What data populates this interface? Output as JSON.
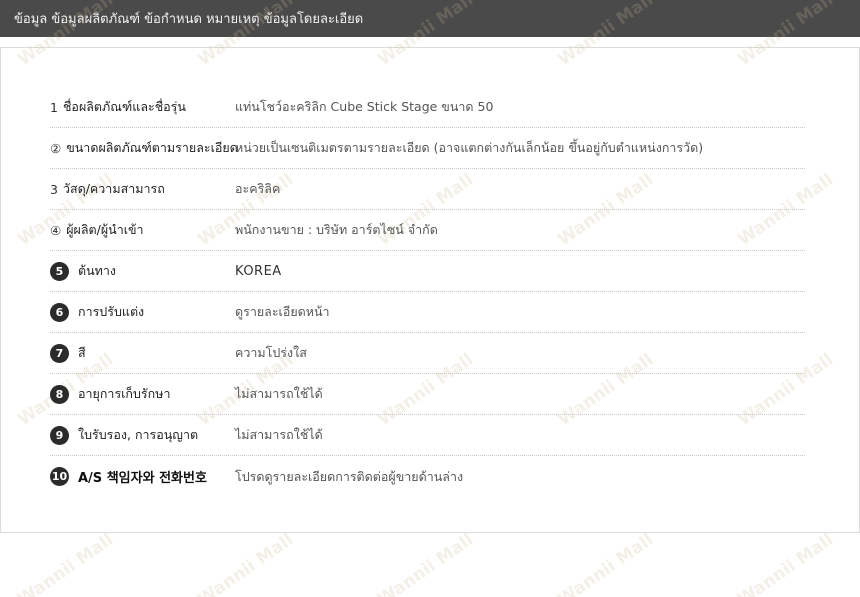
{
  "header": {
    "title": "ข้อมูล ข้อมูลผลิตภัณฑ์ ข้อกำหนด หมายเหตุ ข้อมูลโดยละเอียด"
  },
  "watermark_text": "Wannii Mall",
  "specs": [
    {
      "number": "1",
      "label": "ชื่อผลิตภัณฑ์และชื่อรุ่น",
      "value": "แท่นโชว์อะคริลิก Cube Stick Stage ขนาด 50"
    },
    {
      "number": "②",
      "label": "ขนาดผลิตภัณฑ์ตามรายละเอียด",
      "value": "หน่วยเป็นเซนติเมตรตามรายละเอียด (อาจแตกต่างกันเล็กน้อย ขึ้นอยู่กับตำแหน่งการวัด)"
    },
    {
      "number": "3",
      "label": "วัสดุ/ความสามารถ",
      "value": "อะคริลิค"
    },
    {
      "number": "④",
      "label": "ผู้ผลิต/ผู้นำเข้า",
      "value": "พนักงานขาย : บริษัท อาร์ตไซน์ จำกัด"
    },
    {
      "number": "5",
      "label": "ต้นทาง",
      "value": "KOREA"
    },
    {
      "number": "6",
      "label": "การปรับแต่ง",
      "value": "ดูรายละเอียดหน้า"
    },
    {
      "number": "7",
      "label": "สี",
      "value": "ความโปร่งใส"
    },
    {
      "number": "8",
      "label": "อายุการเก็บรักษา",
      "value": "ไม่สามารถใช้ได้"
    },
    {
      "number": "9",
      "label": "ใบรับรอง, การอนุญาต",
      "value": "ไม่สามารถใช้ได้"
    },
    {
      "number": "10",
      "label": "A/S 책임자와 전화번호",
      "value": "โปรดดูรายละเอียดการติดต่อผู้ขายด้านล่าง"
    }
  ]
}
